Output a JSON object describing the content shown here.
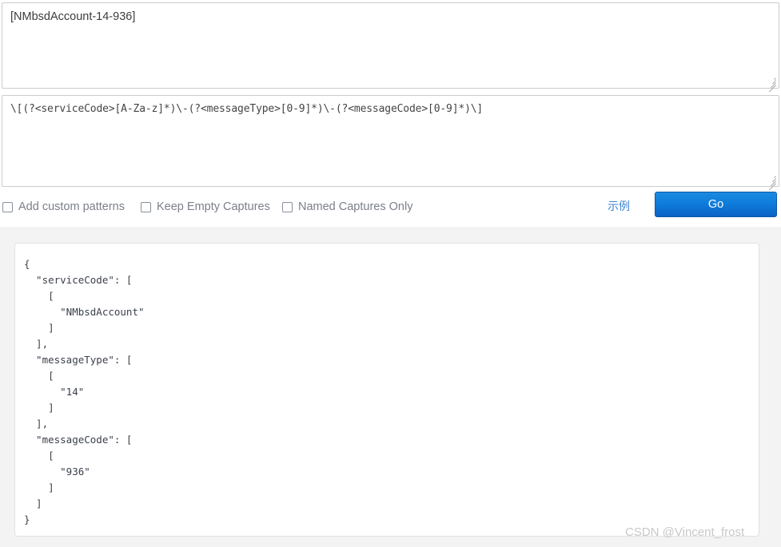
{
  "sample": {
    "value": "[NMbsdAccount-14-936]",
    "placeholder": ""
  },
  "pattern": {
    "value": "\\[(?<serviceCode>[A-Za-z]*)\\-(?<messageType>[0-9]*)\\-(?<messageCode>[0-9]*)\\]",
    "placeholder": ""
  },
  "options": [
    {
      "label": "Add custom patterns",
      "checked": false
    },
    {
      "label": "Keep Empty Captures",
      "checked": false
    },
    {
      "label": "Named Captures Only",
      "checked": false
    }
  ],
  "actions": {
    "example_link": "示例",
    "go_label": "Go"
  },
  "result": {
    "text": "{\n  \"serviceCode\": [\n    [\n      \"NMbsdAccount\"\n    ]\n  ],\n  \"messageType\": [\n    [\n      \"14\"\n    ]\n  ],\n  \"messageCode\": [\n    [\n      \"936\"\n    ]\n  ]\n}"
  },
  "watermark": {
    "text": "CSDN @Vincent_frost"
  },
  "colors": {
    "accent_blue": "#0f7ddb",
    "link_blue": "#3d85d0",
    "panel_gray": "#f3f3f3",
    "border_gray": "#cccccc",
    "label_gray": "#7b7f8a",
    "watermark_gray": "#c8c8c8"
  }
}
